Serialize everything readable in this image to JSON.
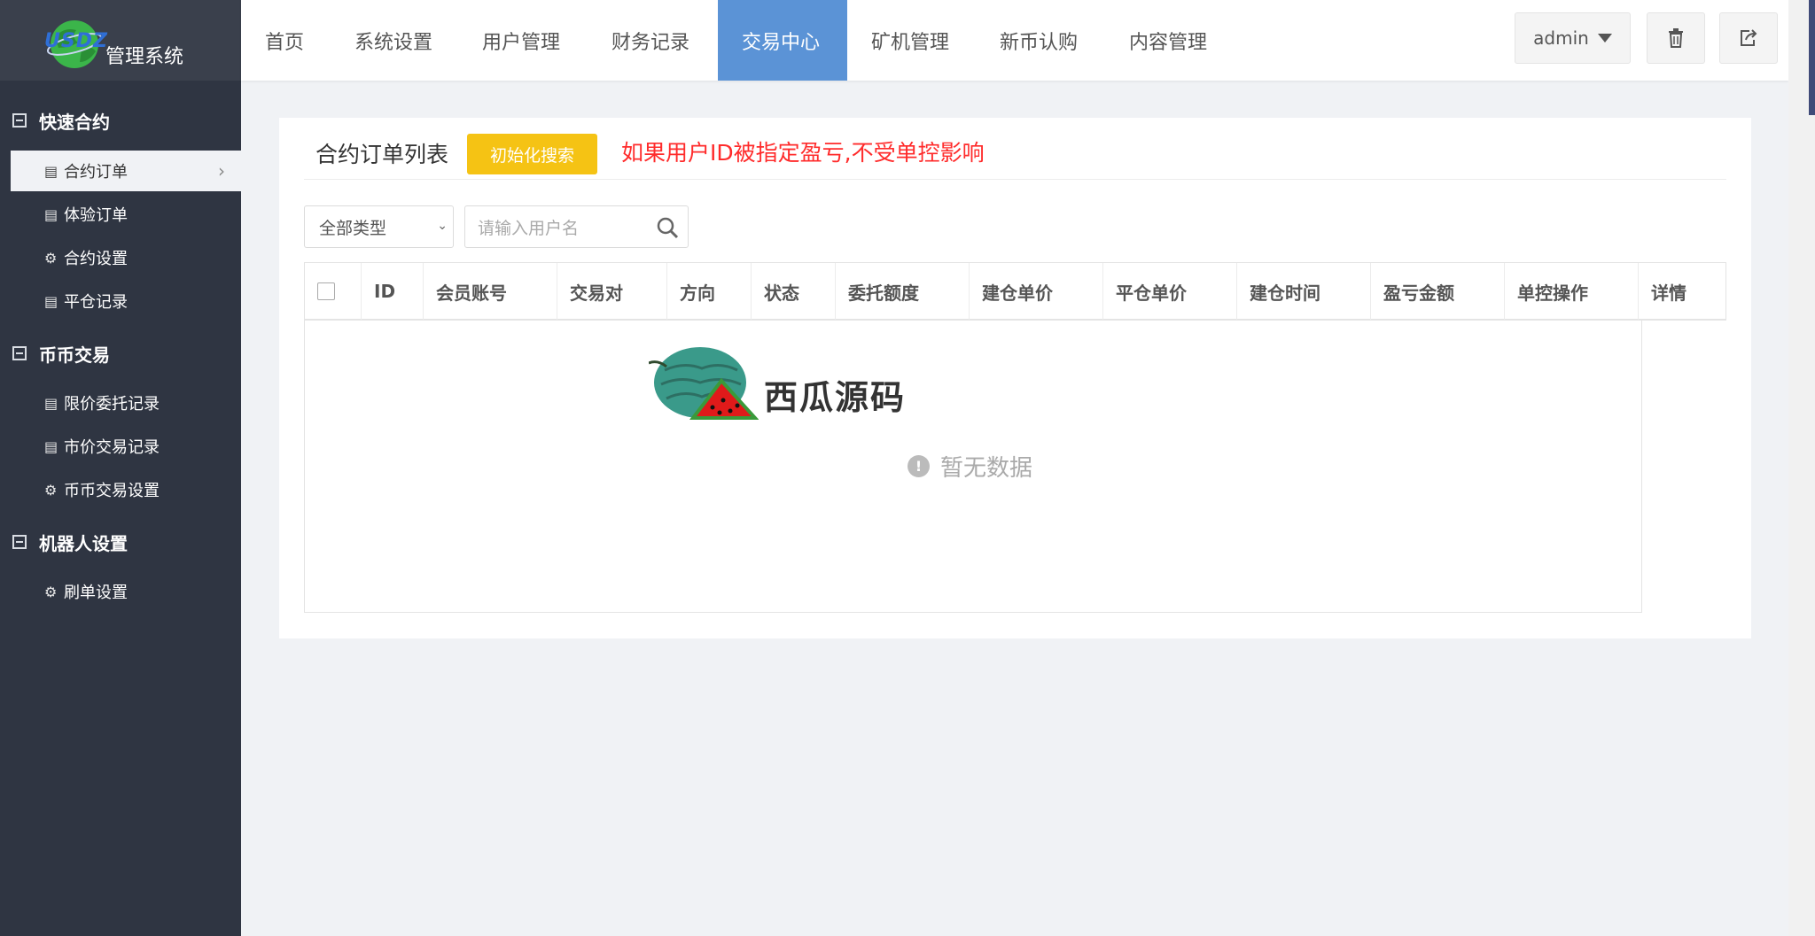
{
  "brand": {
    "logo_mark": "USDZ",
    "name": "管理系统"
  },
  "sidebar": {
    "groups": [
      {
        "label": "快速合约",
        "items": [
          {
            "label": "合约订单",
            "icon": "list-icon"
          },
          {
            "label": "体验订单",
            "icon": "list-icon"
          },
          {
            "label": "合约设置",
            "icon": "gear-icon"
          },
          {
            "label": "平仓记录",
            "icon": "list-icon"
          }
        ]
      },
      {
        "label": "币币交易",
        "items": [
          {
            "label": "限价委托记录",
            "icon": "list-icon"
          },
          {
            "label": "市价交易记录",
            "icon": "list-icon"
          },
          {
            "label": "币币交易设置",
            "icon": "gear-icon"
          }
        ]
      },
      {
        "label": "机器人设置",
        "items": [
          {
            "label": "刷单设置",
            "icon": "gear-icon"
          }
        ]
      }
    ],
    "active_item": "合约订单"
  },
  "nav": {
    "items": [
      "首页",
      "系统设置",
      "用户管理",
      "财务记录",
      "交易中心",
      "矿机管理",
      "新币认购",
      "内容管理"
    ],
    "active": "交易中心"
  },
  "user": {
    "name": "admin"
  },
  "panel": {
    "title": "合约订单列表",
    "init_button": "初始化搜索",
    "warning": "如果用户ID被指定盈亏,不受单控影响",
    "type_select": "全部类型",
    "search_placeholder": "请输入用户名"
  },
  "table": {
    "columns": [
      "ID",
      "会员账号",
      "交易对",
      "方向",
      "状态",
      "委托额度",
      "建仓单价",
      "平仓单价",
      "建仓时间",
      "盈亏金额",
      "单控操作",
      "详情"
    ],
    "empty_text": "暂无数据"
  },
  "watermark": {
    "text": "西瓜源码"
  },
  "colors": {
    "sidebar_bg": "#2f3542",
    "nav_active": "#5b93d6",
    "init_button": "#f5c314",
    "warning": "#ff2b2b"
  }
}
